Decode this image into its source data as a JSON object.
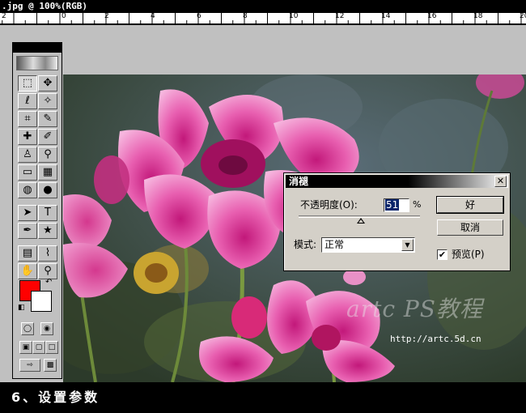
{
  "window": {
    "title": ".jpg @ 100%(RGB)"
  },
  "ruler": {
    "labels": [
      "2",
      "0",
      "2",
      "4",
      "6",
      "8",
      "10",
      "12",
      "14",
      "16",
      "18",
      "20"
    ]
  },
  "toolbox": {
    "foreground_color": "#ff0000",
    "background_color": "#ffffff",
    "tools": [
      {
        "name": "marquee-tool",
        "glyph": "⬚"
      },
      {
        "name": "move-tool",
        "glyph": "✥"
      },
      {
        "name": "lasso-tool",
        "glyph": "ℓ"
      },
      {
        "name": "magic-wand-tool",
        "glyph": "✧"
      },
      {
        "name": "crop-tool",
        "glyph": "⌗"
      },
      {
        "name": "slice-tool",
        "glyph": "✎"
      },
      {
        "name": "healing-brush-tool",
        "glyph": "✚"
      },
      {
        "name": "brush-tool",
        "glyph": "✐"
      },
      {
        "name": "clone-stamp-tool",
        "glyph": "♙"
      },
      {
        "name": "history-brush-tool",
        "glyph": "⚲"
      },
      {
        "name": "eraser-tool",
        "glyph": "▭"
      },
      {
        "name": "gradient-tool",
        "glyph": "▦"
      },
      {
        "name": "blur-tool",
        "glyph": "◍"
      },
      {
        "name": "dodge-tool",
        "glyph": "●"
      },
      {
        "name": "path-selection-tool",
        "glyph": "➤"
      },
      {
        "name": "type-tool",
        "glyph": "T"
      },
      {
        "name": "pen-tool",
        "glyph": "✒"
      },
      {
        "name": "custom-shape-tool",
        "glyph": "★"
      },
      {
        "name": "notes-tool",
        "glyph": "▤"
      },
      {
        "name": "eyedropper-tool",
        "glyph": "⌇"
      },
      {
        "name": "hand-tool",
        "glyph": "✋"
      },
      {
        "name": "zoom-tool",
        "glyph": "⚲"
      }
    ]
  },
  "dialog": {
    "title": "消褪",
    "opacity_label": "不透明度(O):",
    "opacity_value": "51",
    "opacity_unit": "%",
    "opacity_percent": 51,
    "mode_label": "模式:",
    "mode_value": "正常",
    "ok_label": "好",
    "cancel_label": "取消",
    "preview_label": "预览(P)",
    "preview_checked": "✔",
    "close_glyph": "✕"
  },
  "image": {
    "watermark": "artc PS教程",
    "url": "http://artc.5d.cn"
  },
  "caption": {
    "text": "6、设置参数"
  }
}
